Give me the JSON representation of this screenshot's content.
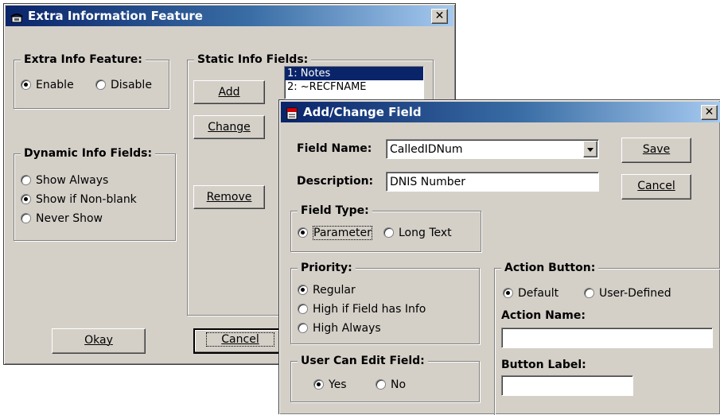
{
  "main_window": {
    "title": "Extra Information Feature",
    "close_glyph": "✕",
    "extra_info": {
      "legend": "Extra Info Feature:",
      "options": [
        {
          "label": "Enable",
          "checked": true
        },
        {
          "label": "Disable",
          "checked": false
        }
      ]
    },
    "dynamic_info": {
      "legend": "Dynamic Info Fields:",
      "options": [
        {
          "label": "Show Always",
          "checked": false
        },
        {
          "label": "Show if Non-blank",
          "checked": true
        },
        {
          "label": "Never Show",
          "checked": false
        }
      ]
    },
    "static_info": {
      "legend": "Static Info Fields:",
      "items": [
        "1: Notes",
        "2: ~RECFNAME"
      ],
      "selected_index": 0,
      "add_label": "Add",
      "change_label": "Change",
      "remove_label": "Remove"
    },
    "okay_label": "Okay",
    "cancel_label": "Cancel"
  },
  "dialog": {
    "title": "Add/Change Field",
    "close_glyph": "✕",
    "field_name_label": "Field Name:",
    "field_name_value": "CalledIDNum",
    "description_label": "Description:",
    "description_value": "DNIS Number",
    "save_label": "Save",
    "cancel_label": "Cancel",
    "field_type": {
      "legend": "Field Type:",
      "options": [
        {
          "label": "Parameter",
          "checked": true
        },
        {
          "label": "Long Text",
          "checked": false
        }
      ]
    },
    "priority": {
      "legend": "Priority:",
      "options": [
        {
          "label": "Regular",
          "checked": true
        },
        {
          "label": "High if Field has Info",
          "checked": false
        },
        {
          "label": "High Always",
          "checked": false
        }
      ]
    },
    "user_edit": {
      "legend": "User Can Edit Field:",
      "options": [
        {
          "label": "Yes",
          "checked": true
        },
        {
          "label": "No",
          "checked": false
        }
      ]
    },
    "action_button": {
      "legend": "Action Button:",
      "options": [
        {
          "label": "Default",
          "checked": true
        },
        {
          "label": "User-Defined",
          "checked": false
        }
      ],
      "action_name_label": "Action Name:",
      "action_name_value": "",
      "button_label_label": "Button Label:",
      "button_label_value": ""
    }
  },
  "colors": {
    "face": "#d4d0c8",
    "title_active": "#0a246a",
    "selection": "#0a246a"
  }
}
